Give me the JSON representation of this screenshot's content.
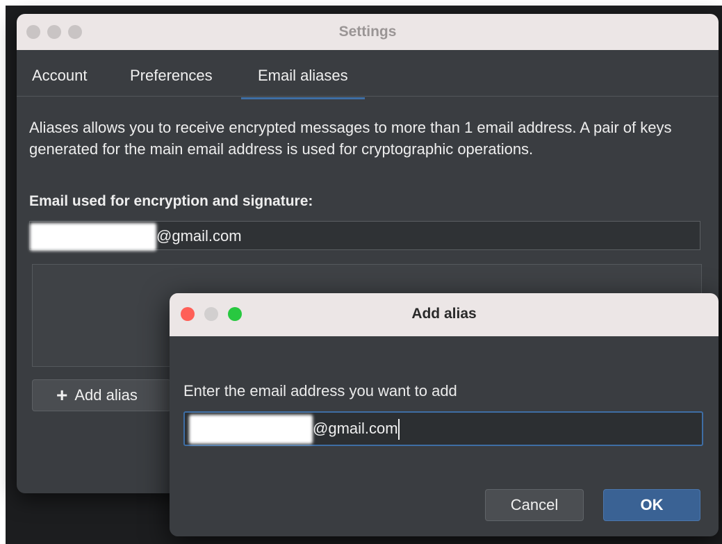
{
  "settings": {
    "title": "Settings",
    "tabs": [
      {
        "label": "Account"
      },
      {
        "label": "Preferences"
      },
      {
        "label": "Email aliases"
      }
    ],
    "description": "Aliases allows you to receive encrypted messages to more than 1 email address. A pair of keys generated for the main email address is used for cryptographic operations.",
    "email_label": "Email used for encryption and signature:",
    "main_email_suffix": "@gmail.com",
    "add_alias_label": "Add alias"
  },
  "dialog": {
    "title": "Add alias",
    "prompt": "Enter the email address you want to add",
    "input_suffix": "@gmail.com",
    "cancel_label": "Cancel",
    "ok_label": "OK"
  },
  "icons": {
    "add": "plus-icon"
  },
  "colors": {
    "accent": "#3f6fa6",
    "ok_button": "#3a6294"
  }
}
